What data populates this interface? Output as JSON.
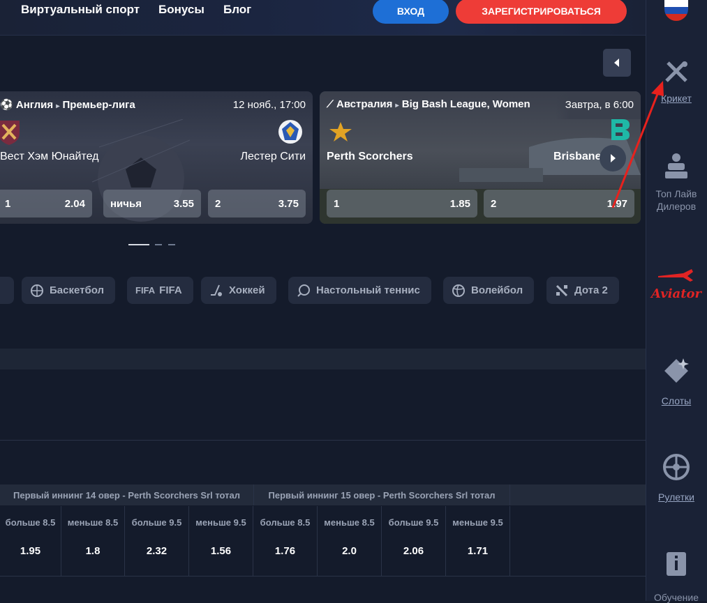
{
  "nav": {
    "virtual_sport": "Виртуальный спорт",
    "bonuses": "Бонусы",
    "blog": "Блог",
    "login": "ВХОД",
    "register": "ЗАРЕГИСТРИРОВАТЬСЯ"
  },
  "colors": {
    "login_button": "#1e6fd6",
    "register_button": "#ee3c37",
    "annotation_arrow": "#e8211d",
    "aviator": "#e02424"
  },
  "sidebar": {
    "cricket": "Крикет",
    "top_live_dealers_1": "Топ Лайв",
    "top_live_dealers_2": "Дилеров",
    "aviator": "Aviator",
    "slots": "Слоты",
    "roulettes": "Рулетки",
    "learning": "Обучение"
  },
  "cards": [
    {
      "country": "Англия",
      "league": "Премьер-лига",
      "date": "12 нояб., 17:00",
      "team1": "Вест Хэм Юнайтед",
      "team2": "Лестер Сити",
      "odds": [
        {
          "label": "1",
          "value": "2.04"
        },
        {
          "label": "ничья",
          "value": "3.55"
        },
        {
          "label": "2",
          "value": "3.75"
        }
      ]
    },
    {
      "country": "Австралия",
      "league": "Big Bash League, Women",
      "date": "Завтра, в 6:00",
      "team1": "Perth Scorchers",
      "team2": "Brisbane Heat",
      "team2_visible": "Brisbane",
      "odds": [
        {
          "label": "1",
          "value": "1.85"
        },
        {
          "label": "2",
          "value": "1.97"
        }
      ]
    }
  ],
  "sports": [
    {
      "label": "Баскетбол",
      "icon": "basketball-icon"
    },
    {
      "label": "FIFA",
      "icon": "fifa-icon"
    },
    {
      "label": "Хоккей",
      "icon": "hockey-icon"
    },
    {
      "label": "Настольный теннис",
      "icon": "table-tennis-icon"
    },
    {
      "label": "Волейбол",
      "icon": "volleyball-icon"
    },
    {
      "label": "Дота 2",
      "icon": "dota2-icon"
    }
  ],
  "markets": [
    {
      "title": "Первый иннинг 14 овер - Perth Scorchers Srl тотал",
      "outcomes": [
        {
          "label": "больше 8.5",
          "value": "1.95"
        },
        {
          "label": "меньше 8.5",
          "value": "1.8"
        },
        {
          "label": "больше 9.5",
          "value": "2.32"
        },
        {
          "label": "меньше 9.5",
          "value": "1.56"
        }
      ]
    },
    {
      "title": "Первый иннинг 15 овер - Perth Scorchers Srl тотал",
      "outcomes": [
        {
          "label": "больше 8.5",
          "value": "1.76"
        },
        {
          "label": "меньше 8.5",
          "value": "2.0"
        },
        {
          "label": "больше 9.5",
          "value": "2.06"
        },
        {
          "label": "меньше 9.5",
          "value": "1.71"
        }
      ]
    }
  ]
}
